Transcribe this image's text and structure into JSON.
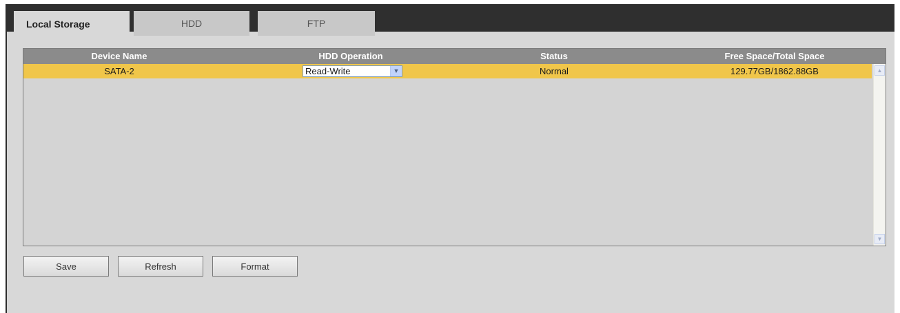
{
  "tabs": [
    {
      "label": "Local Storage",
      "active": true
    },
    {
      "label": "HDD",
      "active": false
    },
    {
      "label": "FTP",
      "active": false
    }
  ],
  "table": {
    "columns": [
      "Device Name",
      "HDD Operation",
      "Status",
      "Free Space/Total Space"
    ],
    "rows": [
      {
        "device_name": "SATA-2",
        "operation": "Read-Write",
        "status": "Normal",
        "space": "129.77GB/1862.88GB"
      }
    ]
  },
  "buttons": {
    "save": "Save",
    "refresh": "Refresh",
    "format": "Format"
  },
  "colors": {
    "tab_bar": "#2f2f2f",
    "panel": "#d8d8d8",
    "header": "#8b8b8b",
    "selected_row": "#f0c64a"
  },
  "icons": {
    "dropdown": "chevron-down-icon",
    "scroll_up": "arrow-up-icon",
    "scroll_down": "arrow-down-icon"
  }
}
